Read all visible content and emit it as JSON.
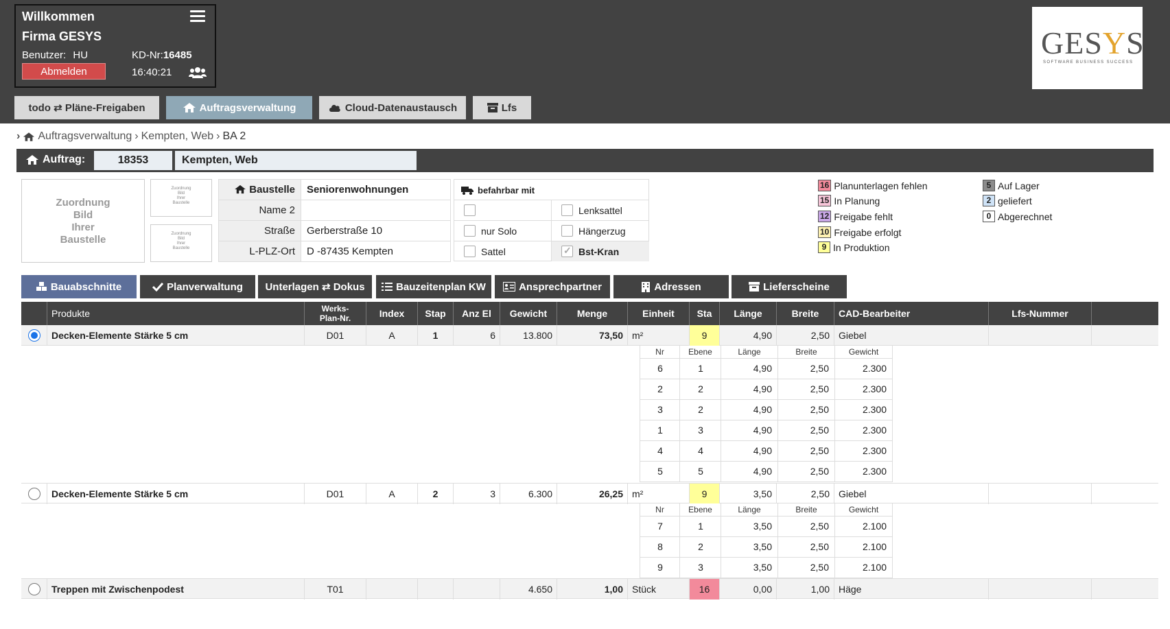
{
  "header": {
    "welcome": "Willkommen",
    "company": "Firma GESYS",
    "user_label": "Benutzer:",
    "user_value": "HU",
    "kd_label": "KD-Nr:",
    "kd_value": "16485",
    "logout_label": "Abmelden",
    "time": "16:40:21"
  },
  "logo": {
    "text_before": "GES",
    "text_accent": "Y",
    "text_after": "S",
    "slogan": "SOFTWARE  BUSINESS  SUCCESS"
  },
  "nav_tabs": [
    {
      "label": "todo ⇄ Pläne-Freigaben"
    },
    {
      "label": "Auftragsverwaltung"
    },
    {
      "label": "Cloud-Datenaustausch"
    },
    {
      "label": "Lfs"
    }
  ],
  "breadcrumb": [
    "Auftragsverwaltung",
    "Kempten, Web",
    "BA 2"
  ],
  "auftrag": {
    "label": "Auftrag:",
    "number": "18353",
    "name": "Kempten, Web"
  },
  "image_placeholder": {
    "line1": "Zuordnung",
    "line2": "Bild",
    "line3": "Ihrer",
    "line4": "Baustelle"
  },
  "baustelle": {
    "title": "Baustelle",
    "name": "Seniorenwohnungen",
    "name2_label": "Name 2",
    "name2": "",
    "street_label": "Straße",
    "street": "Gerberstraße 10",
    "city_label": "L-PLZ-Ort",
    "city": "D -87435 Kempten"
  },
  "befahrbar": {
    "title": "befahrbar mit",
    "options": [
      {
        "label": "",
        "checked": false
      },
      {
        "label": "Lenksattel",
        "checked": false
      },
      {
        "label": "nur Solo",
        "checked": false
      },
      {
        "label": "Hängerzug",
        "checked": false
      },
      {
        "label": "Sattel",
        "checked": false
      },
      {
        "label": "Bst-Kran",
        "checked": true
      }
    ]
  },
  "legend": [
    {
      "badge": "16",
      "label": "Planunterlagen fehlen",
      "color": "#f28a9b"
    },
    {
      "badge": "15",
      "label": "In Planung",
      "color": "#f7c6d9"
    },
    {
      "badge": "12",
      "label": "Freigabe fehlt",
      "color": "#c9a7e6"
    },
    {
      "badge": "10",
      "label": "Freigabe erfolgt",
      "color": "#fff2b3"
    },
    {
      "badge": "9",
      "label": "In Produktion",
      "color": "#ffff99"
    },
    {
      "badge": "5",
      "label": "Auf Lager",
      "color": "#8c8c8c"
    },
    {
      "badge": "2",
      "label": "geliefert",
      "color": "#cfe3f7"
    },
    {
      "badge": "0",
      "label": "Abgerechnet",
      "color": "#ffffff"
    }
  ],
  "actions": [
    {
      "label": "Bauabschnitte"
    },
    {
      "label": "Planverwaltung"
    },
    {
      "label": "Unterlagen ⇄ Dokus"
    },
    {
      "label": "Bauzeitenplan KW"
    },
    {
      "label": "Ansprechpartner"
    },
    {
      "label": "Adressen"
    },
    {
      "label": "Lieferscheine"
    }
  ],
  "table": {
    "headers": {
      "produkte": "Produkte",
      "werks1": "Werks-",
      "werks2": "Plan-Nr.",
      "index": "Index",
      "stap": "Stap",
      "anz": "Anz El",
      "gewicht": "Gewicht",
      "menge": "Menge",
      "einheit": "Einheit",
      "sta": "Sta",
      "laenge": "Länge",
      "breite": "Breite",
      "cad": "CAD-Bearbeiter",
      "lfs": "Lfs-Nummer"
    },
    "sub_headers": {
      "nr": "Nr",
      "ebene": "Ebene",
      "laenge": "Länge",
      "breite": "Breite",
      "gewicht": "Gewicht"
    },
    "rows": [
      {
        "selected": true,
        "produkt": "Decken-Elemente Stärke 5 cm",
        "werks": "D01",
        "index": "A",
        "stap": "1",
        "anz": "6",
        "gewicht": "13.800",
        "menge": "73,50",
        "einheit": "m²",
        "sta": "9",
        "laenge": "4,90",
        "breite": "2,50",
        "cad": "Giebel",
        "lfs": "",
        "elements": [
          {
            "nr": "6",
            "ebene": "1",
            "laenge": "4,90",
            "breite": "2,50",
            "gewicht": "2.300"
          },
          {
            "nr": "2",
            "ebene": "2",
            "laenge": "4,90",
            "breite": "2,50",
            "gewicht": "2.300"
          },
          {
            "nr": "3",
            "ebene": "2",
            "laenge": "4,90",
            "breite": "2,50",
            "gewicht": "2.300"
          },
          {
            "nr": "1",
            "ebene": "3",
            "laenge": "4,90",
            "breite": "2,50",
            "gewicht": "2.300"
          },
          {
            "nr": "4",
            "ebene": "4",
            "laenge": "4,90",
            "breite": "2,50",
            "gewicht": "2.300"
          },
          {
            "nr": "5",
            "ebene": "5",
            "laenge": "4,90",
            "breite": "2,50",
            "gewicht": "2.300"
          }
        ]
      },
      {
        "selected": false,
        "produkt": "Decken-Elemente Stärke 5 cm",
        "werks": "D01",
        "index": "A",
        "stap": "2",
        "anz": "3",
        "gewicht": "6.300",
        "menge": "26,25",
        "einheit": "m²",
        "sta": "9",
        "laenge": "3,50",
        "breite": "2,50",
        "cad": "Giebel",
        "lfs": "",
        "elements": [
          {
            "nr": "7",
            "ebene": "1",
            "laenge": "3,50",
            "breite": "2,50",
            "gewicht": "2.100"
          },
          {
            "nr": "8",
            "ebene": "2",
            "laenge": "3,50",
            "breite": "2,50",
            "gewicht": "2.100"
          },
          {
            "nr": "9",
            "ebene": "3",
            "laenge": "3,50",
            "breite": "2,50",
            "gewicht": "2.100"
          }
        ]
      },
      {
        "selected": false,
        "produkt": "Treppen mit Zwischenpodest",
        "werks": "T01",
        "index": "",
        "stap": "",
        "anz": "",
        "gewicht": "4.650",
        "menge": "1,00",
        "einheit": "Stück",
        "sta": "16",
        "laenge": "0,00",
        "breite": "1,00",
        "cad": "Häge",
        "lfs": ""
      }
    ]
  }
}
